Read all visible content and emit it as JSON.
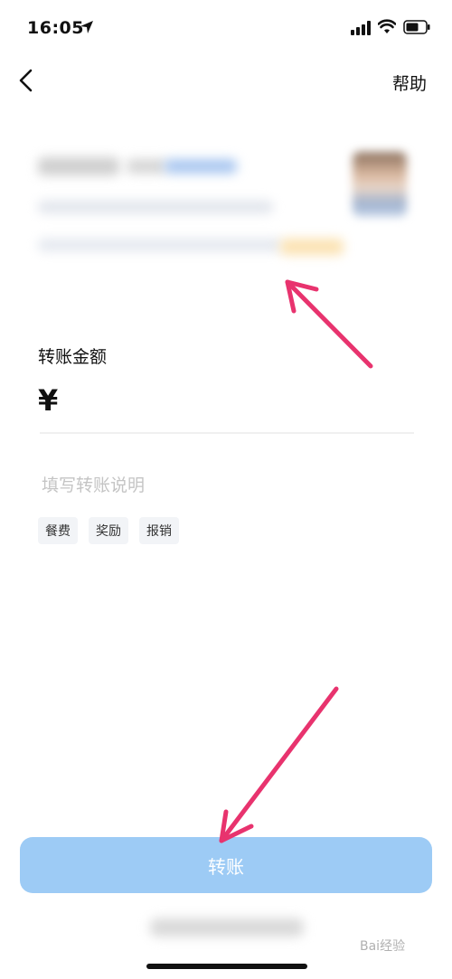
{
  "status_bar": {
    "time": "16:05"
  },
  "nav": {
    "help": "帮助"
  },
  "amount": {
    "label": "转账金额",
    "currency": "¥",
    "value": ""
  },
  "note": {
    "placeholder": "填写转账说明"
  },
  "tags": [
    "餐费",
    "奖励",
    "报销"
  ],
  "transfer_button": "转账",
  "watermark": "Bai经验",
  "colors": {
    "primary_button": "#9dcbf5",
    "annotation_arrow": "#e8336e",
    "tag_bg": "#f2f4f7"
  }
}
